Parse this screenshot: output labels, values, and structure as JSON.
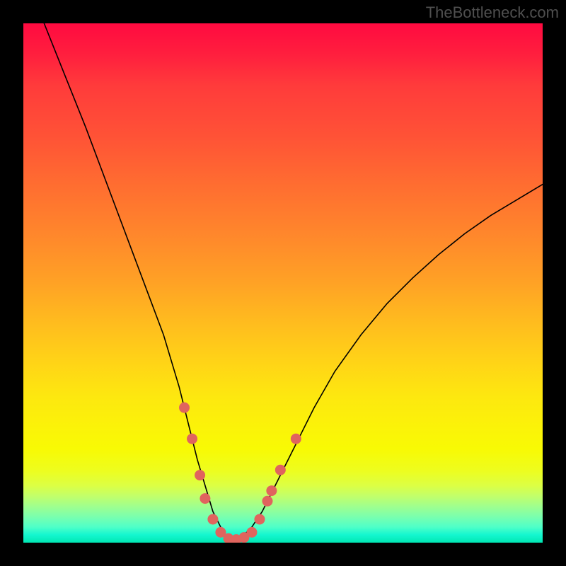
{
  "watermark": "TheBottleneck.com",
  "chart_data": {
    "type": "line",
    "title": "",
    "xlabel": "",
    "ylabel": "",
    "xlim": [
      0,
      100
    ],
    "ylim": [
      0,
      100
    ],
    "grid": false,
    "series": [
      {
        "name": "bottleneck-curve",
        "x": [
          4,
          8,
          12,
          15,
          18,
          21,
          24,
          27,
          30,
          32,
          33.5,
          35,
          36.5,
          38,
          39,
          40,
          41,
          42,
          44,
          46,
          48,
          50,
          53,
          56,
          60,
          65,
          70,
          75,
          80,
          85,
          90,
          95,
          100
        ],
        "y": [
          100,
          90,
          80,
          72,
          64,
          56,
          48,
          40,
          30,
          22,
          16,
          11,
          6,
          3,
          1.2,
          0.5,
          0.5,
          1,
          3,
          6,
          10,
          14,
          20,
          26,
          33,
          40,
          46,
          51,
          55.5,
          59.5,
          63,
          66,
          69
        ],
        "stroke": "#000000",
        "stroke_width": 1.6
      }
    ],
    "markers": {
      "name": "highlight-points",
      "color": "#e0645e",
      "radius": 7.5,
      "points": [
        {
          "x": 31.0,
          "y": 26.0
        },
        {
          "x": 32.5,
          "y": 20.0
        },
        {
          "x": 34.0,
          "y": 13.0
        },
        {
          "x": 35.0,
          "y": 8.5
        },
        {
          "x": 36.5,
          "y": 4.5
        },
        {
          "x": 38.0,
          "y": 2.0
        },
        {
          "x": 39.5,
          "y": 0.8
        },
        {
          "x": 41.0,
          "y": 0.6
        },
        {
          "x": 42.5,
          "y": 1.0
        },
        {
          "x": 44.0,
          "y": 2.0
        },
        {
          "x": 45.5,
          "y": 4.5
        },
        {
          "x": 47.0,
          "y": 8.0
        },
        {
          "x": 47.8,
          "y": 10.0
        },
        {
          "x": 49.5,
          "y": 14.0
        },
        {
          "x": 52.5,
          "y": 20.0
        }
      ]
    }
  }
}
